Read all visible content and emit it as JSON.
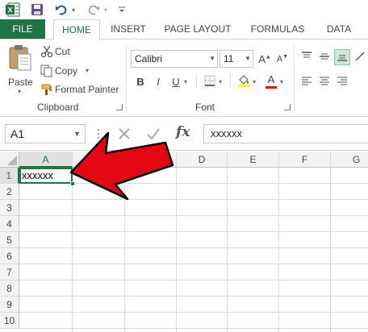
{
  "quick_access": {
    "app_icon": "excel-logo-icon",
    "items": [
      "save-icon",
      "undo-icon",
      "redo-icon",
      "customize-qat-icon"
    ]
  },
  "tabs": [
    {
      "label": "FILE"
    },
    {
      "label": "HOME"
    },
    {
      "label": "INSERT"
    },
    {
      "label": "PAGE LAYOUT"
    },
    {
      "label": "FORMULAS"
    },
    {
      "label": "DATA"
    }
  ],
  "clipboard": {
    "paste_label": "Paste",
    "cut_label": "Cut",
    "copy_label": "Copy",
    "format_painter_label": "Format Painter",
    "group_label": "Clipboard"
  },
  "font": {
    "font_name": "Calibri",
    "font_size": "11",
    "group_label": "Font",
    "bold_label": "B",
    "italic_label": "I",
    "underline_label": "U",
    "font_color_label": "A",
    "fill_color": "#ffff00",
    "font_color": "#ff0000"
  },
  "formula_bar": {
    "name_box": "A1",
    "fx_label": "fx",
    "formula_value": "xxxxxx"
  },
  "grid": {
    "columns": [
      "A",
      "B",
      "C",
      "D",
      "E",
      "F",
      "G"
    ],
    "rows": [
      "1",
      "2",
      "3",
      "4",
      "5",
      "6",
      "7",
      "8",
      "9",
      "10"
    ],
    "cell_A1": "xxxxxx"
  },
  "colors": {
    "accent": "#217346",
    "arrow": "#e30613"
  }
}
